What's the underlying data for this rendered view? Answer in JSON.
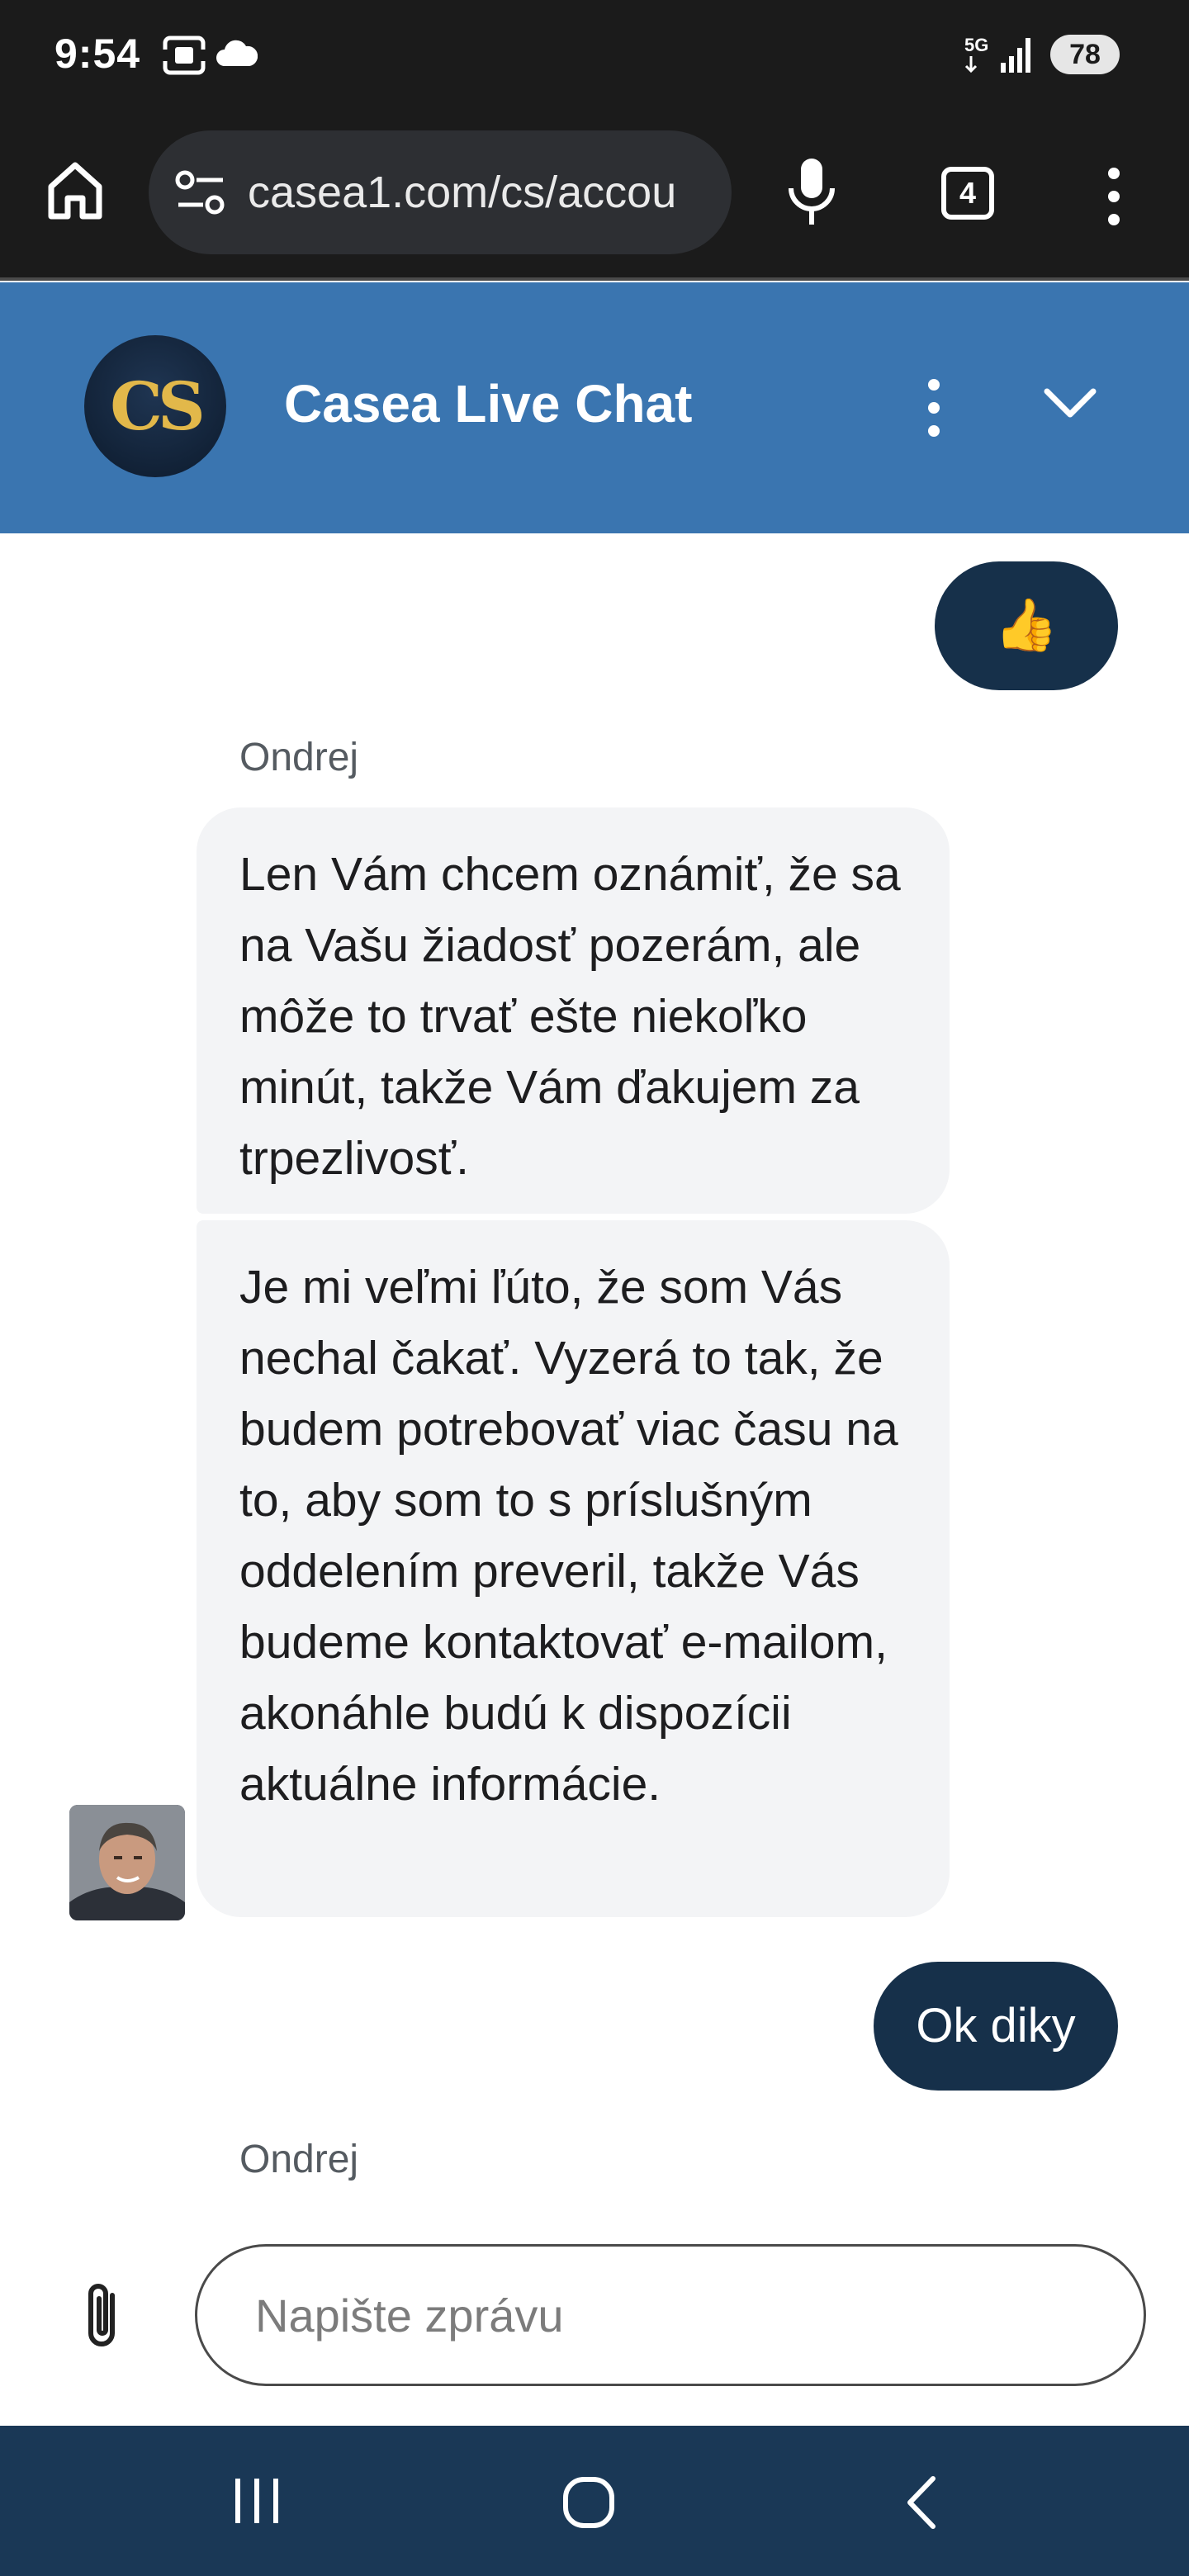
{
  "status_bar": {
    "time": "9:54",
    "network": "5G",
    "battery": "78",
    "icons": [
      "screenshot-icon",
      "cloud-icon",
      "signal-icon"
    ]
  },
  "browser": {
    "url": "casea1.com/cs/accou",
    "tab_count": "4",
    "icons": [
      "home-icon",
      "site-settings-icon",
      "microphone-icon",
      "tabs-icon",
      "more-vert-icon"
    ]
  },
  "chat_header": {
    "logo_text": "CS",
    "title": "Casea Live Chat",
    "icons": [
      "more-vert-icon",
      "chevron-down-icon"
    ]
  },
  "messages": [
    {
      "type": "outgoing",
      "text": "👍"
    },
    {
      "type": "sender",
      "text": "Ondrej"
    },
    {
      "type": "incoming",
      "text": "Len Vám chcem oznámiť, že sa na Vašu žiadosť pozerám, ale môže to trvať ešte niekoľko minút, takže Vám ďakujem za trpezlivosť."
    },
    {
      "type": "incoming",
      "text": "Je mi veľmi ľúto, že som Vás nechal čakať. Vyzerá to tak, že budem potrebovať viac času na to, aby som to s príslušným oddelením preveril, takže Vás budeme kontaktovať e-mailom, akonáhle budú k dispozícii aktuálne informácie."
    },
    {
      "type": "outgoing",
      "text": "Ok diky"
    },
    {
      "type": "sender",
      "text": "Ondrej"
    }
  ],
  "composer": {
    "placeholder": "Napište zprávu",
    "icons": [
      "attachment-icon"
    ]
  },
  "nav_bar": {
    "icons": [
      "recent-apps-icon",
      "home-circle-icon",
      "back-icon"
    ]
  },
  "colors": {
    "header_blue": "#3a75b0",
    "outgoing_bubble": "#16304a",
    "incoming_bubble": "#f3f4f6",
    "nav_bar": "#1a3856"
  }
}
